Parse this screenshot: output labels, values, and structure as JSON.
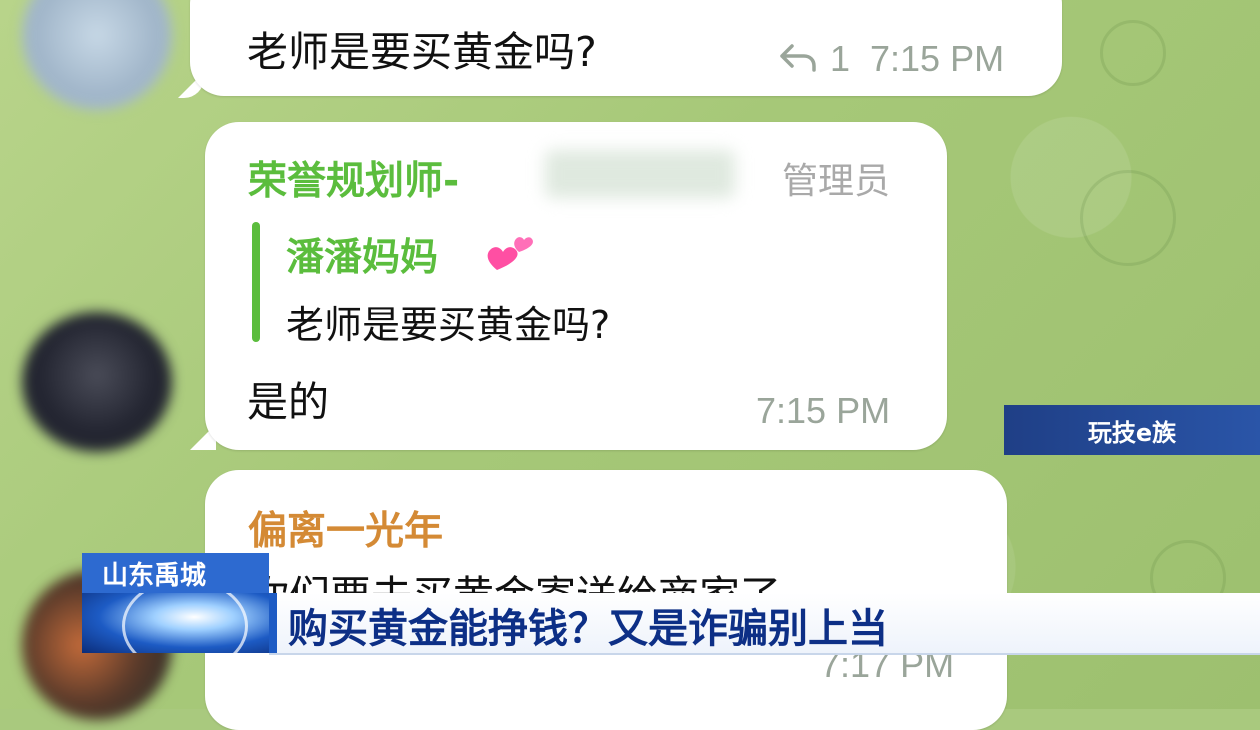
{
  "messages": [
    {
      "text": "老师是要买黄金吗?",
      "reply_count": "1",
      "time": "7:15 PM"
    },
    {
      "sender": "荣誉规划师-",
      "role": "管理员",
      "quote_sender": "潘潘妈妈",
      "quote_text": "老师是要买黄金吗?",
      "text": "是的",
      "time": "7:15 PM"
    },
    {
      "sender": "偏离一光年",
      "text": "你们要去买黄金寄送给商家了",
      "time": "7:17 PM"
    }
  ],
  "overlay": {
    "channel_logo": "玩技e族",
    "location": "山东禹城",
    "headline": "购买黄金能挣钱？又是诈骗别上当"
  },
  "colors": {
    "chat_background": "#a9c97e",
    "sender_green": "#5bbd3d",
    "sender_orange": "#d48a35",
    "headline_blue": "#0d2f86",
    "location_blue": "#2d6ad0"
  },
  "icons": [
    "reply-arrow-icon",
    "heart-emoji-icon",
    "globe-icon"
  ]
}
